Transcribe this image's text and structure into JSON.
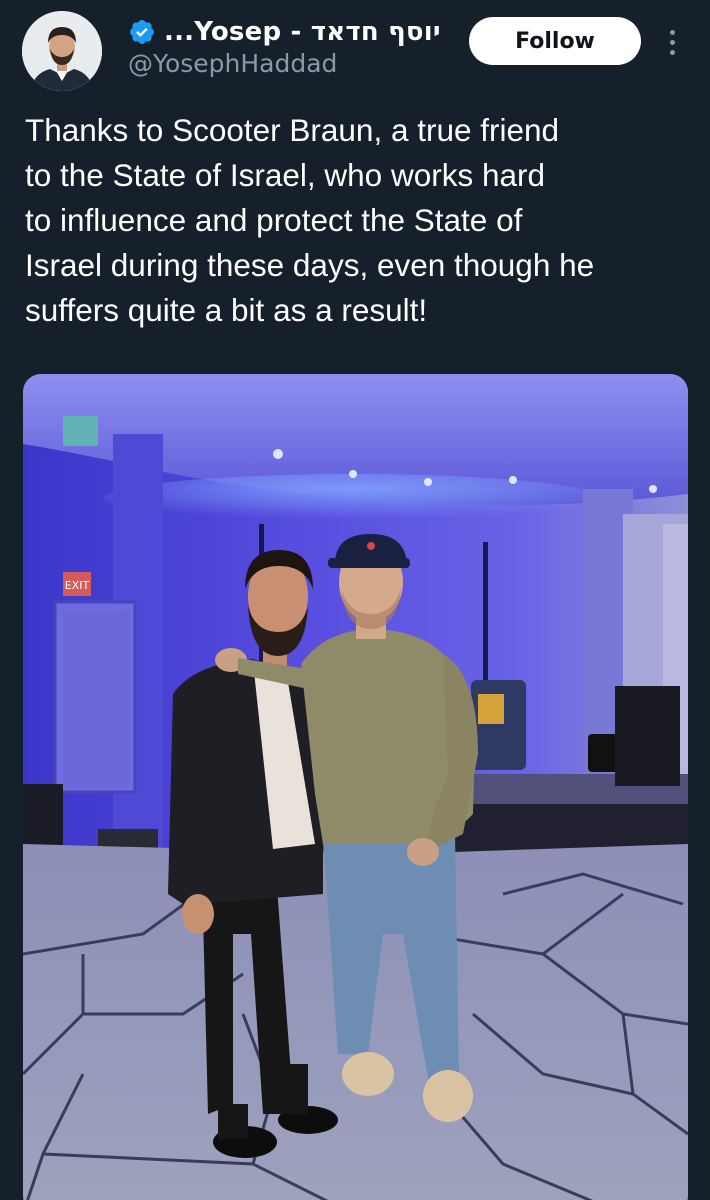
{
  "author": {
    "display_name": "...Yosep - יוסף חדאד",
    "handle": "@YosephHaddad",
    "verified": true,
    "verified_color": "#1d9bf0",
    "avatar_icon": "profile-photo"
  },
  "actions": {
    "follow_label": "Follow",
    "more_icon": "more-vertical-icon"
  },
  "tweet": {
    "text": "Thanks to Scooter Braun, a true friend\nto the State of Israel, who works hard\nto influence and protect the State of\nIsrael during these days, even though he\nsuffers quite a bit as a result!"
  },
  "media": {
    "exit_sign": "EXIT"
  },
  "colors": {
    "background": "#15202b",
    "secondary_text": "#8b98a5",
    "follow_bg": "#ffffff"
  }
}
